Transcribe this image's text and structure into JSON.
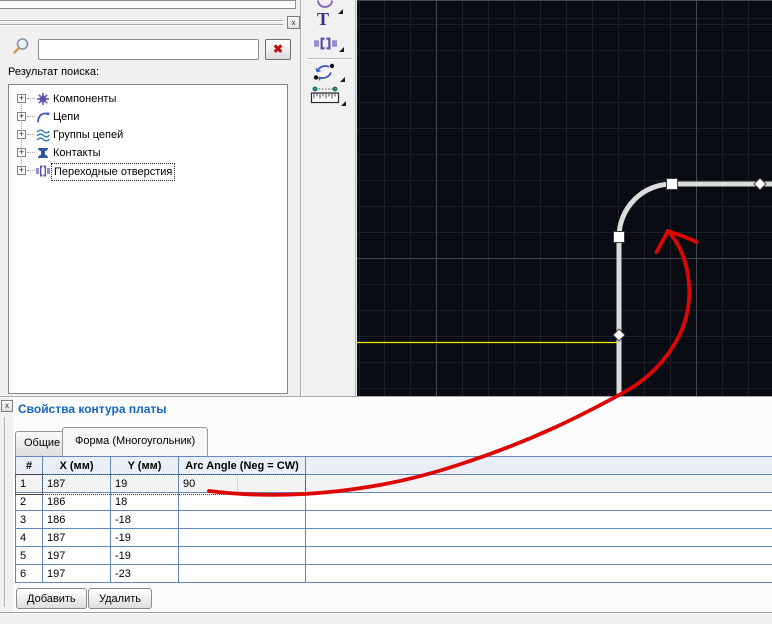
{
  "chrome": {
    "collapse_glyph": "x"
  },
  "left_panel": {
    "search": {
      "value": "",
      "clear_label": "✖"
    },
    "results_label": "Результат поиска:",
    "expander_glyph": "+",
    "tree": [
      {
        "label": "Компоненты",
        "icon": "component-icon"
      },
      {
        "label": "Цепи",
        "icon": "net-icon"
      },
      {
        "label": "Группы цепей",
        "icon": "net-group-icon"
      },
      {
        "label": "Контакты",
        "icon": "pad-icon"
      },
      {
        "label": "Переходные отверстия",
        "icon": "via-icon",
        "selected": true
      }
    ]
  },
  "toolbar": {
    "items": [
      {
        "icon": "arc-tool-icon"
      },
      {
        "icon": "text-tool-icon",
        "glyph": "T"
      },
      {
        "icon": "via-tool-icon"
      },
      {
        "icon": "rotate-tool-icon"
      },
      {
        "icon": "measure-tool-icon"
      }
    ]
  },
  "canvas": {
    "colors": {
      "background": "#090c12",
      "grid_minor": "#1d2127",
      "grid_major": "#46494f",
      "outline": "#dcdcdc",
      "crosshair": "#f0f000",
      "annotation": "#dd0505"
    }
  },
  "bottom_panel": {
    "title": "Свойства контура платы",
    "tabs": [
      {
        "label": "Общие"
      },
      {
        "label": "Форма (Многоугольник)",
        "active": true
      }
    ],
    "table": {
      "headers": [
        "#",
        "X (мм)",
        "Y (мм)",
        "Arc Angle (Neg = CW)"
      ],
      "rows": [
        {
          "num": "1",
          "x": "187",
          "y": "19",
          "arc": "90"
        },
        {
          "num": "2",
          "x": "186",
          "y": "18",
          "arc": ""
        },
        {
          "num": "3",
          "x": "186",
          "y": "-18",
          "arc": ""
        },
        {
          "num": "4",
          "x": "187",
          "y": "-19",
          "arc": ""
        },
        {
          "num": "5",
          "x": "197",
          "y": "-19",
          "arc": ""
        },
        {
          "num": "6",
          "x": "197",
          "y": "-23",
          "arc": ""
        }
      ]
    },
    "buttons": [
      {
        "label": "Добавить"
      },
      {
        "label": "Удалить"
      }
    ]
  }
}
